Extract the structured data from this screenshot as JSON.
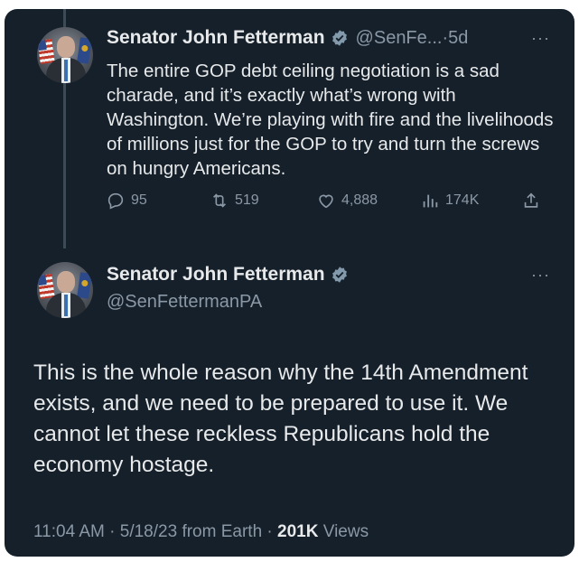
{
  "tweet1": {
    "author_name": "Senator John Fetterman",
    "handle": "@SenFe...",
    "time_sep": " · ",
    "age": "5d",
    "more": "···",
    "text": "The entire GOP debt ceiling negotiation is a sad charade, and it’s exactly what’s wrong with Washington. We’re playing with fire and the livelihoods of millions just for the GOP to try and turn the screws on hungry Americans.",
    "actions": {
      "replies": "95",
      "retweets": "519",
      "likes": "4,888",
      "views": "174K"
    }
  },
  "tweet2": {
    "author_name": "Senator John Fetterman",
    "handle": "@SenFettermanPA",
    "more": "···",
    "text": "This is the whole reason why the 14th Amendment exists, and we need to be prepared to use it. We cannot let these reckless Republicans hold the economy hostage.",
    "meta": {
      "time": "11:04 AM",
      "date": "5/18/23",
      "source": "from Earth",
      "sep": " · ",
      "views_count": "201K",
      "views_label": "Views"
    }
  },
  "colors": {
    "background": "#15202b",
    "text": "#e7e9ea",
    "secondary": "#8b98a5",
    "verified": "#829aab"
  },
  "icons": [
    "verified-badge-icon",
    "more-icon",
    "reply-icon",
    "retweet-icon",
    "like-icon",
    "views-icon",
    "share-icon"
  ]
}
